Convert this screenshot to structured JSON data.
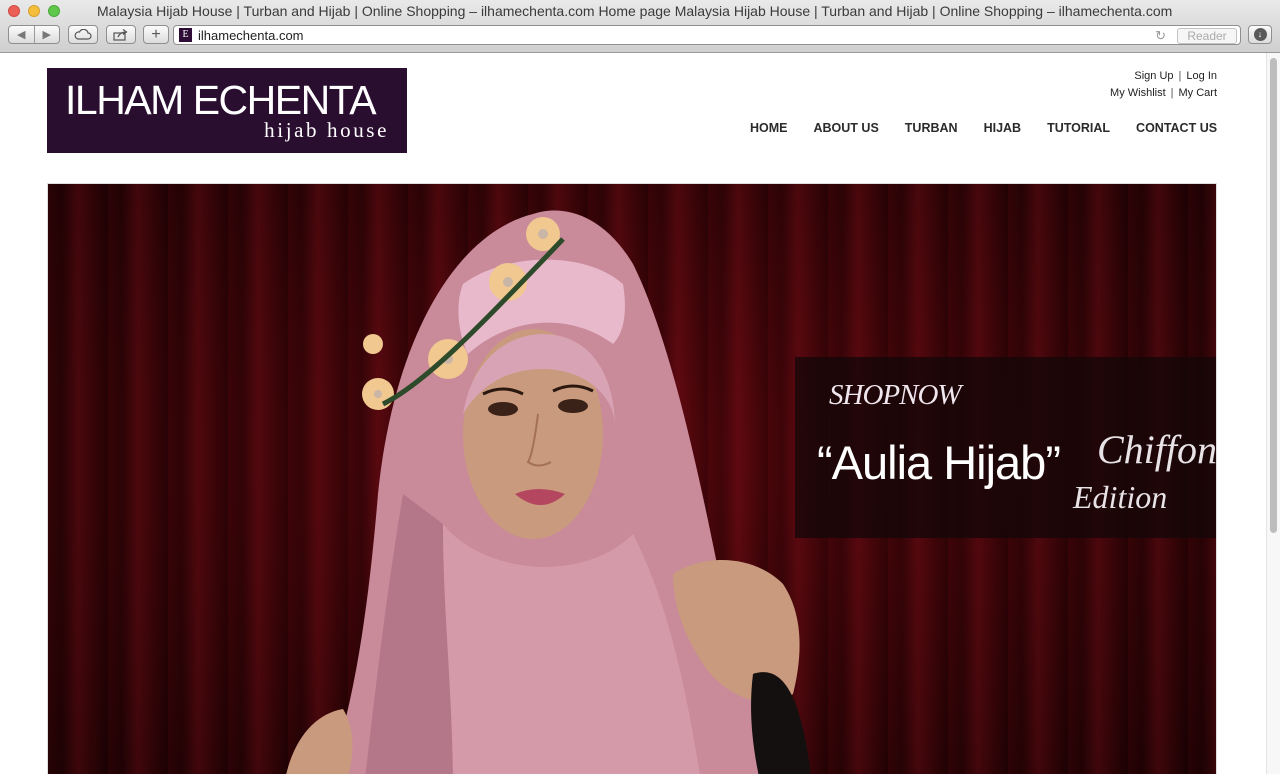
{
  "window": {
    "title": "Malaysia Hijab House | Turban and Hijab | Online Shopping – ilhamechenta.com Home page Malaysia Hijab House | Turban and Hijab | Online Shopping – ilhamechenta.com"
  },
  "toolbar": {
    "back_glyph": "◀",
    "forward_glyph": "▶",
    "new_tab_glyph": "+",
    "url": "ilhamechenta.com",
    "favicon_letter": "E",
    "reload_glyph": "↻",
    "reader_label": "Reader"
  },
  "logo": {
    "main": "ILHAM ECHENTA",
    "sub": "hijab house",
    "background": "#2a0e30"
  },
  "account": {
    "sign_up": "Sign Up",
    "log_in": "Log In",
    "wishlist": "My Wishlist",
    "cart": "My Cart",
    "separator": "|"
  },
  "nav": {
    "items": [
      "HOME",
      "ABOUT US",
      "TURBAN",
      "HIJAB",
      "TUTORIAL",
      "CONTACT US"
    ]
  },
  "hero": {
    "shop_now": "SHOPNOW",
    "product": "“Aulia Hijab”",
    "edition_line1": "Chiffon",
    "edition_line2": "Edition"
  }
}
